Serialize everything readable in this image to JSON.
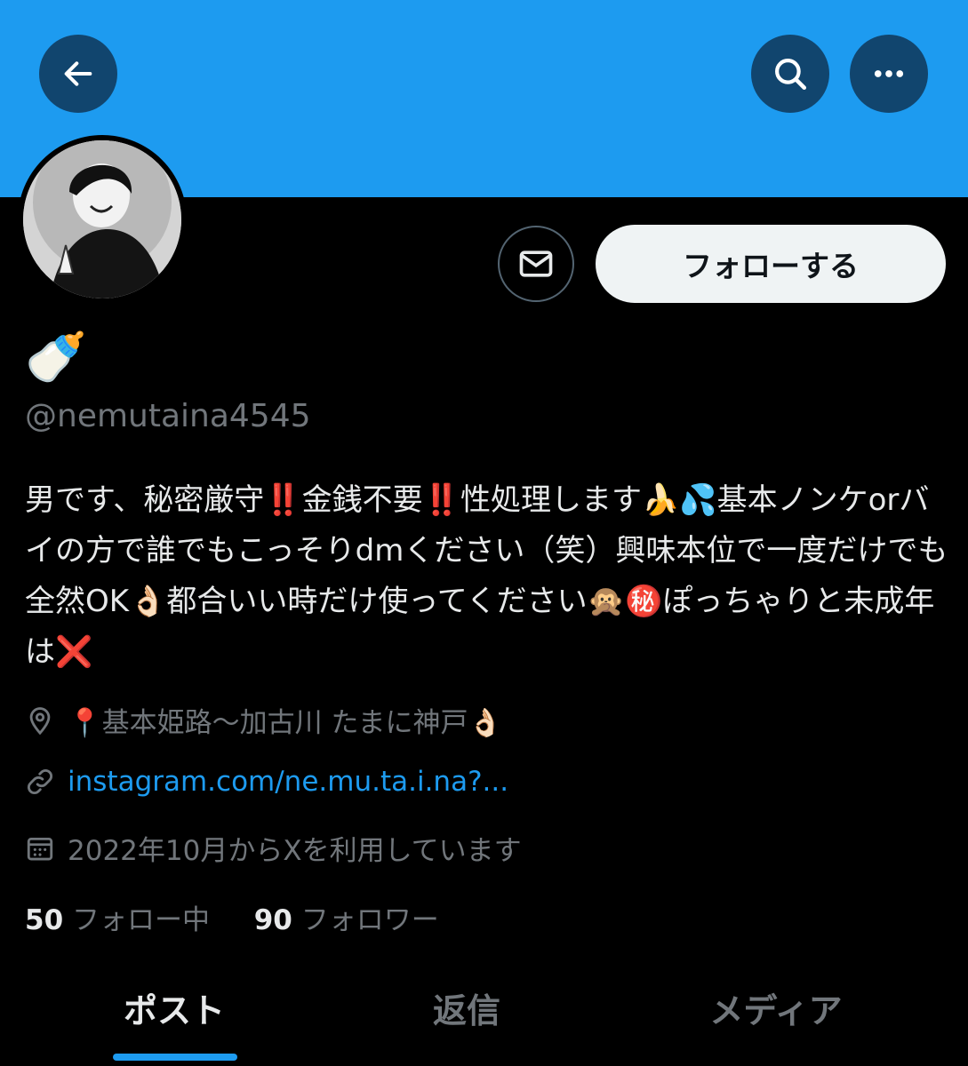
{
  "header": {
    "back_icon": "arrow-left-icon",
    "search_icon": "search-icon",
    "more_icon": "more-dots-icon"
  },
  "profile": {
    "display_name": "🍼",
    "handle": "@nemutaina4545",
    "follow_label": "フォローする",
    "message_icon": "envelope-icon",
    "bio": "男です、秘密厳守‼️金銭不要‼️性処理します🍌💦基本ノンケorバイの方で誰でもこっそりdmください（笑）興味本位で一度だけでも全然OK👌🏻都合いい時だけ使ってください🙊㊙️ぽっちゃりと未成年は❌",
    "location": "📍基本姫路〜加古川 たまに神戸👌🏻",
    "link": "instagram.com/ne.mu.ta.i.na?...",
    "joined": "2022年10月からXを利用しています"
  },
  "stats": {
    "following_count": "50",
    "following_label": "フォロー中",
    "followers_count": "90",
    "followers_label": "フォロワー"
  },
  "tabs": [
    {
      "label": "ポスト",
      "active": true
    },
    {
      "label": "返信",
      "active": false
    },
    {
      "label": "メディア",
      "active": false
    }
  ],
  "colors": {
    "accent": "#1d9bf0",
    "background": "#000000",
    "muted_text": "#71767b"
  }
}
